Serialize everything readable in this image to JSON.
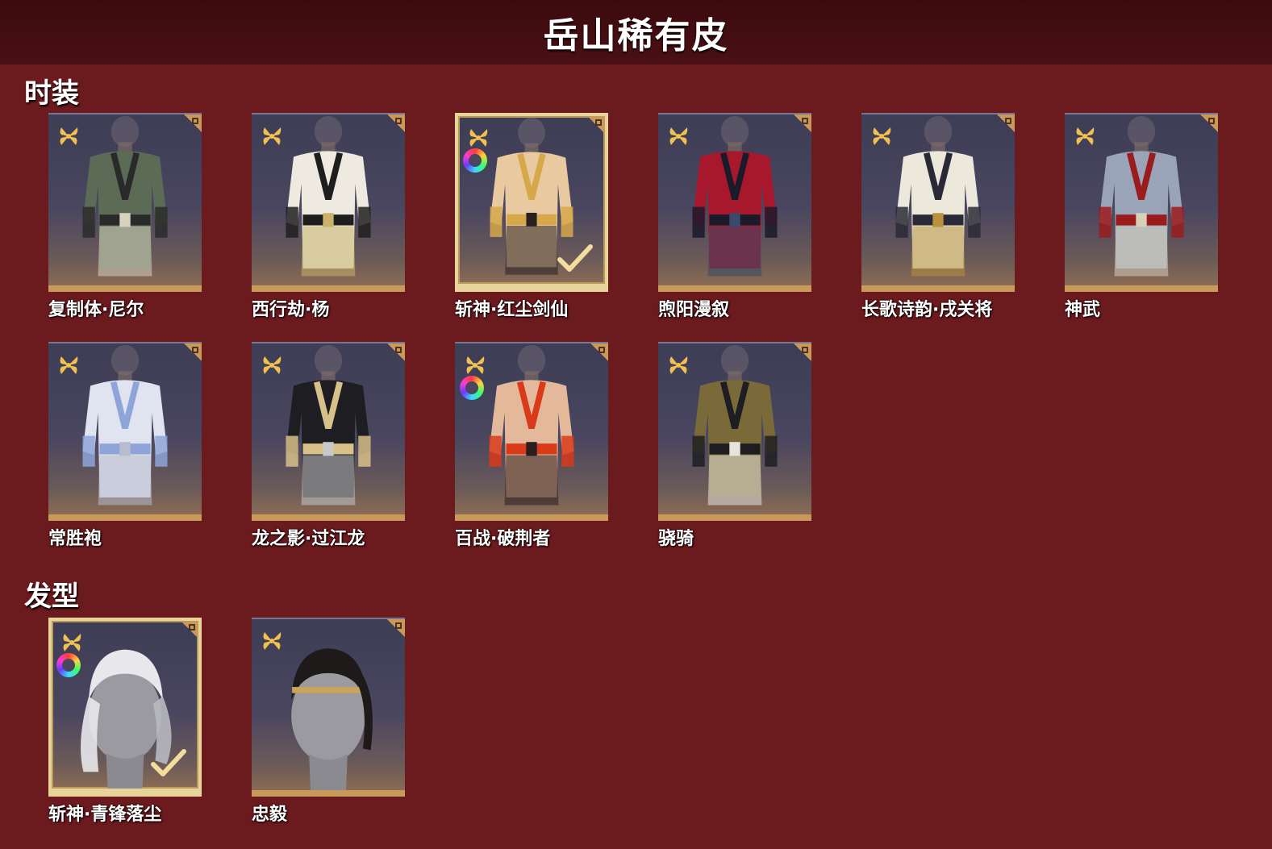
{
  "header": {
    "title": "岳山稀有皮"
  },
  "sections": {
    "outfits": {
      "title": "时装",
      "items": [
        {
          "name": "复制体·尼尔",
          "selected": false,
          "dyeable": false,
          "icon": "outfit-green-armor"
        },
        {
          "name": "西行劫·杨",
          "selected": false,
          "dyeable": false,
          "icon": "outfit-white-robe"
        },
        {
          "name": "斩神·红尘剑仙",
          "selected": true,
          "dyeable": true,
          "icon": "outfit-bare-gold"
        },
        {
          "name": "煦阳漫叙",
          "selected": false,
          "dyeable": false,
          "icon": "outfit-red-shirt"
        },
        {
          "name": "长歌诗韵·戌关将",
          "selected": false,
          "dyeable": false,
          "icon": "outfit-white-armor"
        },
        {
          "name": "神武",
          "selected": false,
          "dyeable": false,
          "icon": "outfit-silver-armor"
        },
        {
          "name": "常胜袍",
          "selected": false,
          "dyeable": false,
          "icon": "outfit-silver-robe"
        },
        {
          "name": "龙之影·过江龙",
          "selected": false,
          "dyeable": false,
          "icon": "outfit-black-vest"
        },
        {
          "name": "百战·破荆者",
          "selected": false,
          "dyeable": true,
          "icon": "outfit-bare-lava"
        },
        {
          "name": "骁骑",
          "selected": false,
          "dyeable": false,
          "icon": "outfit-gold-armor"
        }
      ]
    },
    "hair": {
      "title": "发型",
      "items": [
        {
          "name": "斩神·青锋落尘",
          "selected": true,
          "dyeable": true,
          "icon": "hair-white-long"
        },
        {
          "name": "忠毅",
          "selected": false,
          "dyeable": false,
          "icon": "hair-black-ponytail"
        }
      ]
    }
  },
  "colors": {
    "background": "#6b1a1e",
    "header": "#3a0b0e",
    "card_border": "#c9995a",
    "selected_border": "#e8d49a",
    "rarity_icon": "#f0c050"
  }
}
